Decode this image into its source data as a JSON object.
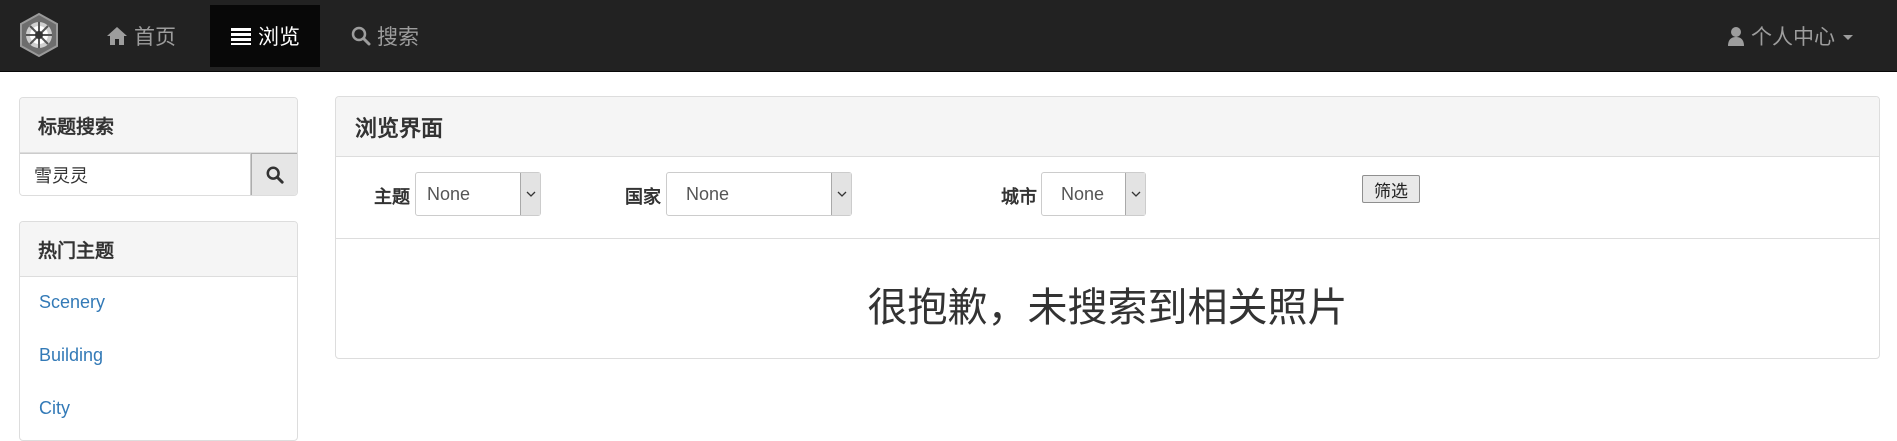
{
  "navbar": {
    "brand_icon": "emblem-logo-icon",
    "home": {
      "label": "首页",
      "icon": "home-icon"
    },
    "browse": {
      "label": "浏览",
      "icon": "list-icon"
    },
    "search": {
      "label": "搜索",
      "icon": "search-icon"
    },
    "user": {
      "label": "个人中心",
      "icon": "user-icon"
    }
  },
  "sidebar": {
    "title_search": {
      "heading": "标题搜索",
      "input_value": "雪灵灵"
    },
    "hot_topics": {
      "heading": "热门主题",
      "items": [
        {
          "label": "Scenery"
        },
        {
          "label": "Building"
        },
        {
          "label": "City"
        }
      ]
    }
  },
  "main": {
    "heading": "浏览界面",
    "filters": {
      "topic": {
        "label": "主题",
        "selected": "None"
      },
      "country": {
        "label": "国家",
        "selected": "None"
      },
      "city": {
        "label": "城市",
        "selected": "None"
      },
      "submit_label": "筛选"
    },
    "empty_message": "很抱歉，未搜索到相关照片"
  },
  "colors": {
    "navbar_bg": "#222222",
    "navbar_active": "#080808",
    "link": "#337ab7",
    "panel_heading_bg": "#f5f5f5"
  }
}
